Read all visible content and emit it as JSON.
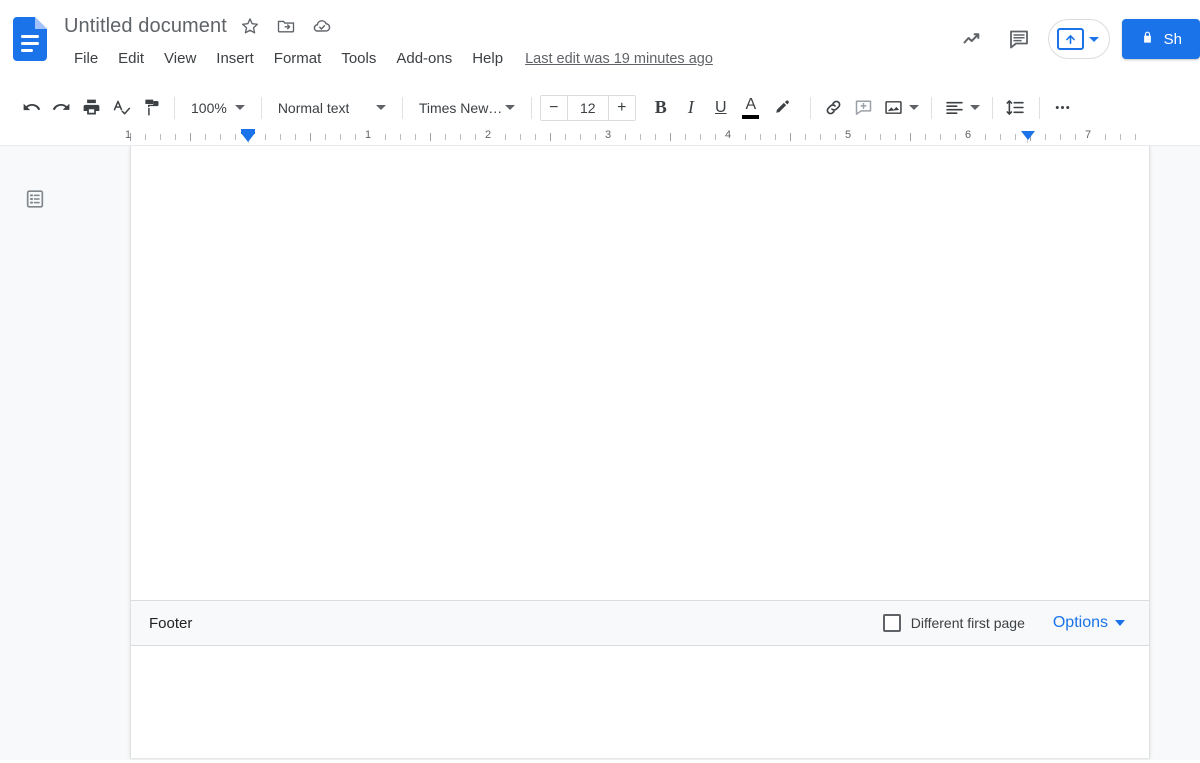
{
  "header": {
    "logo_icon": "google-docs-logo-icon",
    "doc_title": "Untitled document",
    "star_icon": "star-icon",
    "move_folder_icon": "move-to-folder-icon",
    "cloud_saved_icon": "cloud-check-icon",
    "menus": [
      "File",
      "Edit",
      "View",
      "Insert",
      "Format",
      "Tools",
      "Add-ons",
      "Help"
    ],
    "last_edit": "Last edit was 19 minutes ago",
    "activity_icon": "trending-up-icon",
    "comments_icon": "comment-icon",
    "present_icon": "present-upload-icon",
    "present_caret_icon": "chevron-down-icon",
    "share_lock_icon": "lock-icon",
    "share_label": "Sh"
  },
  "toolbar": {
    "undo_icon": "undo-icon",
    "redo_icon": "redo-icon",
    "print_icon": "print-icon",
    "spellcheck_icon": "spellcheck-icon",
    "paint_format_icon": "paint-format-icon",
    "zoom_value": "100%",
    "style_value": "Normal text",
    "font_value": "Times New…",
    "font_size_minus": "−",
    "font_size_value": "12",
    "font_size_plus": "+",
    "bold_label": "B",
    "italic_label": "I",
    "underline_label": "U",
    "text_color_label": "A",
    "text_color_hex": "#000000",
    "highlight_icon": "highlight-pen-icon",
    "link_icon": "insert-link-icon",
    "comment_icon": "add-comment-icon",
    "image_icon": "insert-image-icon",
    "align_icon": "align-left-icon",
    "line_spacing_icon": "line-spacing-icon",
    "more_icon": "more-options-icon"
  },
  "ruler": {
    "major_labels": [
      "1",
      "1",
      "2",
      "3",
      "4",
      "5",
      "6",
      "7"
    ],
    "left_indent_icon": "left-indent-marker-icon",
    "right_indent_icon": "right-indent-marker-icon"
  },
  "workspace": {
    "outline_icon": "document-outline-icon"
  },
  "footer_section": {
    "label": "Footer",
    "checkbox_icon": "checkbox-unchecked-icon",
    "checkbox_label": "Different first page",
    "options_label": "Options",
    "options_caret_icon": "chevron-down-icon"
  },
  "colors": {
    "accent_blue": "#1a73e8",
    "text_dark": "#3c4043",
    "text_muted": "#5f6368",
    "canvas_gray": "#f8f9fa"
  }
}
